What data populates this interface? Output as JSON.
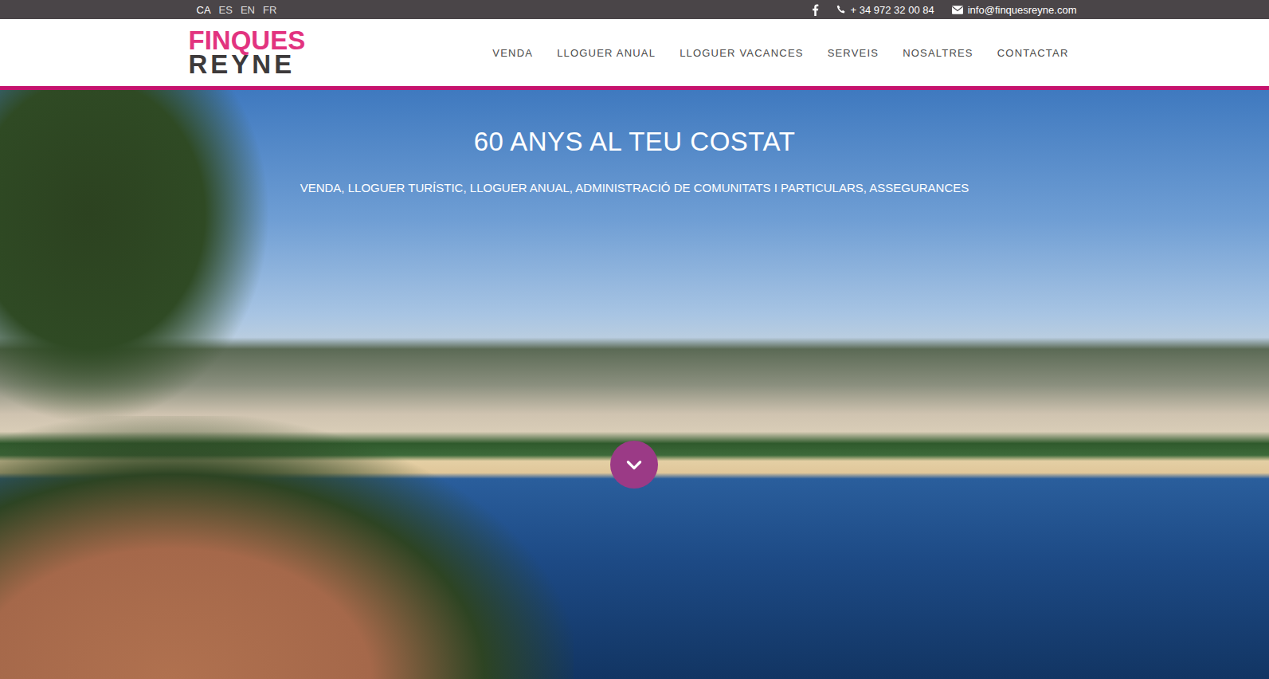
{
  "top_bar": {
    "languages": [
      {
        "label": "CA",
        "selected": true
      },
      {
        "label": "ES",
        "selected": false
      },
      {
        "label": "EN",
        "selected": false
      },
      {
        "label": "FR",
        "selected": false
      }
    ],
    "phone": "+ 34 972 32 00 84",
    "email": "info@finquesreyne.com"
  },
  "logo": {
    "line1": "FINQUES",
    "line2": "REYNE"
  },
  "nav": [
    {
      "label": "VENDA",
      "selected": false
    },
    {
      "label": "LLOGUER ANUAL",
      "selected": false
    },
    {
      "label": "LLOGUER VACANCES",
      "selected": false
    },
    {
      "label": "SERVEIS",
      "selected": false
    },
    {
      "label": "NOSALTRES",
      "selected": false
    },
    {
      "label": "CONTACTAR",
      "selected": false
    }
  ],
  "hero": {
    "title": "60 ANYS AL TEU COSTAT",
    "subtitle": "VENDA, LLOGUER TURÍSTIC, LLOGUER ANUAL, ADMINISTRACIÓ DE COMUNITATS I PARTICULARS, ASSEGURANCES"
  }
}
